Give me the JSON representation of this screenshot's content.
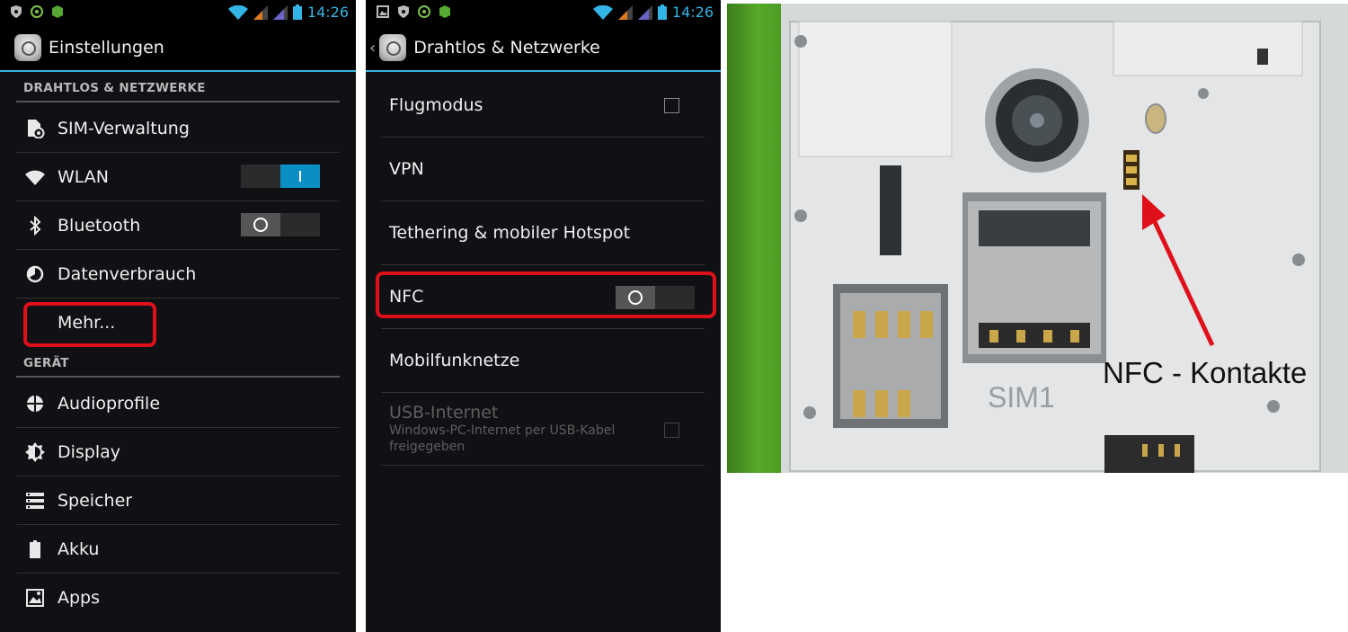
{
  "status_bar": {
    "time": "14:26"
  },
  "screen1": {
    "title": "Einstellungen",
    "sections": [
      {
        "header": "DRAHTLOS & NETZWERKE",
        "items": [
          {
            "label": "SIM-Verwaltung",
            "icon": "sim-settings-icon"
          },
          {
            "label": "WLAN",
            "icon": "wifi-icon",
            "toggle": "on"
          },
          {
            "label": "Bluetooth",
            "icon": "bluetooth-icon",
            "toggle": "off"
          },
          {
            "label": "Datenverbrauch",
            "icon": "data-usage-icon"
          },
          {
            "label": "Mehr...",
            "highlighted": true
          }
        ]
      },
      {
        "header": "GERÄT",
        "items": [
          {
            "label": "Audioprofile",
            "icon": "audio-profile-icon"
          },
          {
            "label": "Display",
            "icon": "display-icon"
          },
          {
            "label": "Speicher",
            "icon": "storage-icon"
          },
          {
            "label": "Akku",
            "icon": "battery-icon"
          },
          {
            "label": "Apps",
            "icon": "apps-icon"
          }
        ]
      }
    ]
  },
  "screen2": {
    "title": "Drahtlos & Netzwerke",
    "items": [
      {
        "label": "Flugmodus",
        "control": "checkbox"
      },
      {
        "label": "VPN"
      },
      {
        "label": "Tethering & mobiler Hotspot"
      },
      {
        "label": "NFC",
        "control": "toggle-off",
        "highlighted": true
      },
      {
        "label": "Mobilfunknetze"
      },
      {
        "label": "USB-Internet",
        "summary": "Windows-PC-Internet per USB-Kabel freigegeben",
        "disabled": true,
        "control": "checkbox"
      }
    ]
  },
  "photo": {
    "annotation": "NFC - Kontakte",
    "arrow_color": "#e0101b",
    "printed_text": "SIM1"
  },
  "colors": {
    "accent": "#33b5e5",
    "highlight": "#e0101b",
    "toggle_on": "#0a8fc4"
  }
}
